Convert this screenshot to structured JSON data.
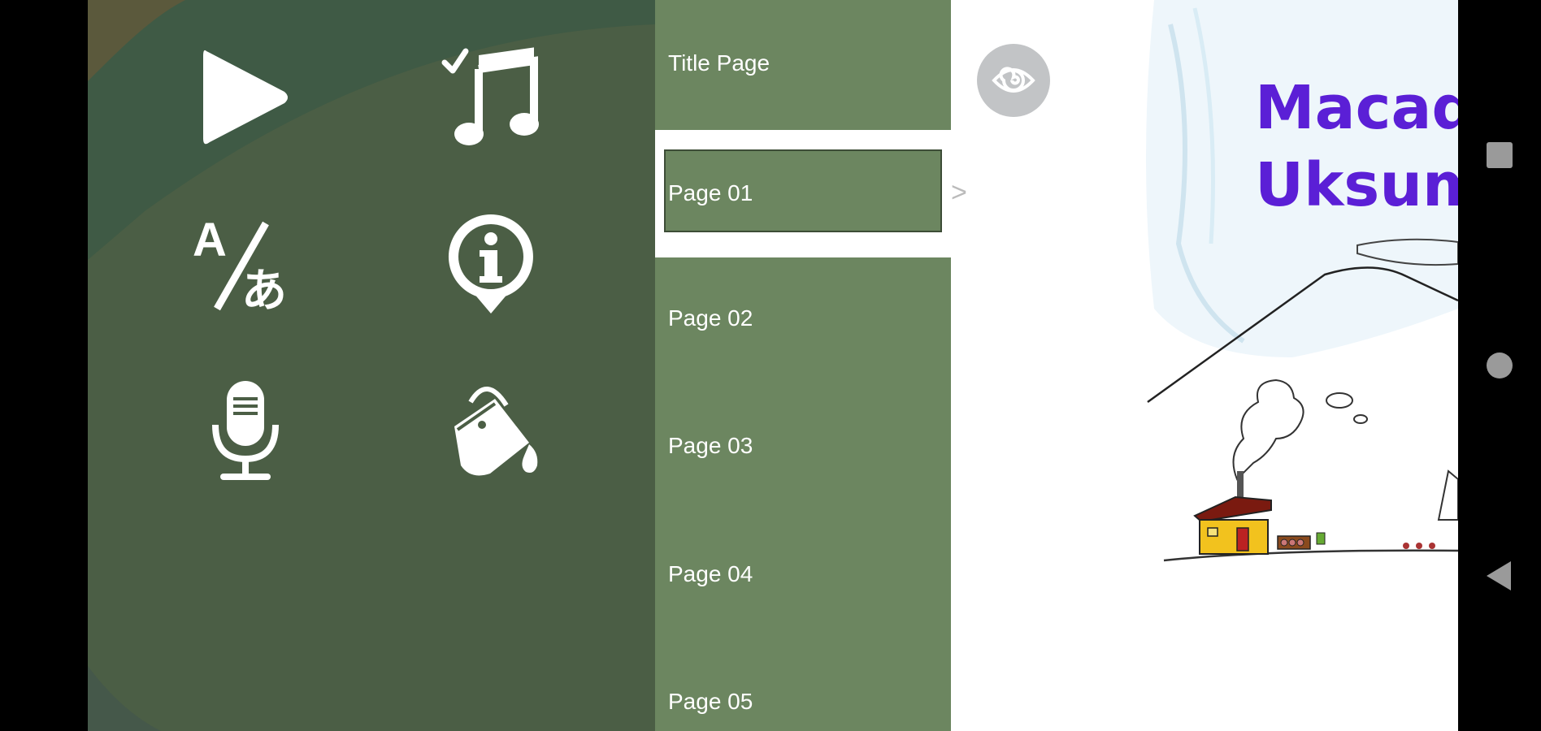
{
  "menu": {
    "buttons": [
      {
        "name": "play-button",
        "icon": "play-icon"
      },
      {
        "name": "music-toggle-button",
        "icon": "music-check-icon"
      },
      {
        "name": "language-button",
        "icon": "translate-icon"
      },
      {
        "name": "info-button",
        "icon": "info-icon"
      },
      {
        "name": "record-button",
        "icon": "microphone-icon"
      },
      {
        "name": "paint-button",
        "icon": "paint-bucket-icon"
      }
    ]
  },
  "pages": {
    "items": [
      {
        "label": "Title Page"
      },
      {
        "label": "Page 01"
      },
      {
        "label": "Page 02"
      },
      {
        "label": "Page 03"
      },
      {
        "label": "Page 04"
      },
      {
        "label": "Page 05"
      }
    ],
    "selected_index": 1
  },
  "content": {
    "arrow": ">",
    "title_line1": "Macaq I",
    "title_line2": "Uksumu"
  },
  "colors": {
    "menu_bg": "#4b5e45",
    "list_bg": "#6c8660",
    "title": "#5b1fd6"
  },
  "navbar": {
    "recents": "square-icon",
    "home": "circle-icon",
    "back": "triangle-back-icon"
  }
}
